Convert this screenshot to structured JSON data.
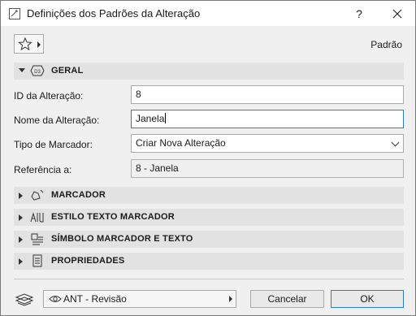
{
  "window": {
    "title": "Definições dos Padrões da Alteração",
    "help_label": "?",
    "close_icon": "close-icon"
  },
  "toolbar": {
    "preset_label": "Padrão"
  },
  "geral": {
    "label": "GERAL",
    "id_label": "ID da Alteração:",
    "id_value": "8",
    "name_label": "Nome da Alteração:",
    "name_value": "Janela",
    "marker_type_label": "Tipo de Marcador:",
    "marker_type_value": "Criar Nova Alteração",
    "ref_label": "Referência a:",
    "ref_value": "8 - Janela"
  },
  "sections": [
    {
      "label": "MARCADOR",
      "icon": "marker-shape-icon"
    },
    {
      "label": "ESTILO TEXTO MARCADOR",
      "icon": "text-style-icon"
    },
    {
      "label": "SÍMBOLO MARCADOR E TEXTO",
      "icon": "symbol-text-icon"
    },
    {
      "label": "PROPRIEDADES",
      "icon": "properties-icon"
    }
  ],
  "footer": {
    "layer_value": "ANT - Revisão",
    "cancel_label": "Cancelar",
    "ok_label": "OK"
  },
  "colors": {
    "accent": "#2b7bd6",
    "section_bg": "#e2e2e2",
    "window_bg": "#f0f0f0"
  }
}
